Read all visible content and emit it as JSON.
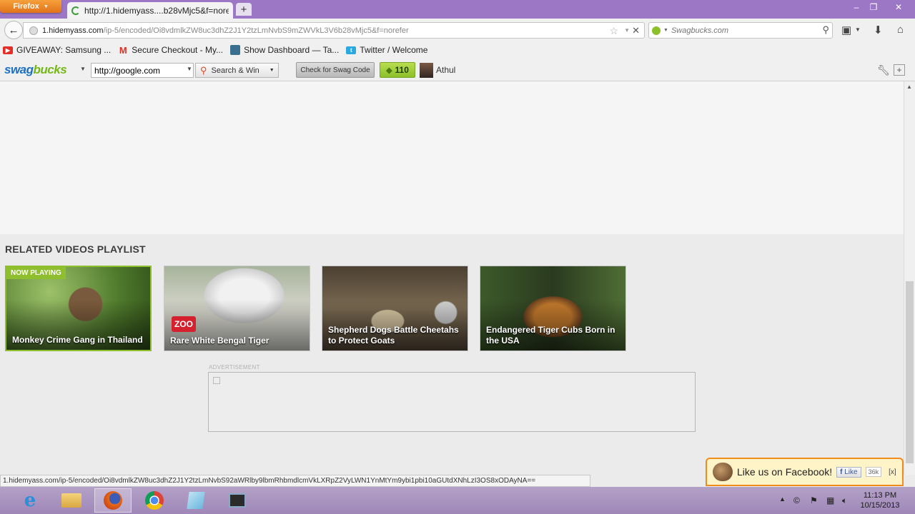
{
  "browser": {
    "menu_label": "Firefox",
    "tab_title": "http://1.hidemyass....b28vMjc5&f=norefer",
    "new_tab_symbol": "+",
    "url_domain": "1.hidemyass.com",
    "url_path": "/ip-5/encoded/Oi8vdmlkZW8uc3dhZ2J1Y2tzLmNvbS9mZWVkL3V6b28vMjc5&f=norefer",
    "search_placeholder": "Swagbucks.com"
  },
  "bookmarks": [
    {
      "label": "GIVEAWAY: Samsung ...",
      "icon": "youtube-icon",
      "color": "#e52d27"
    },
    {
      "label": "Secure Checkout - My...",
      "icon": "gmail-icon",
      "color": "#d93025"
    },
    {
      "label": "Show Dashboard — Ta...",
      "icon": "dashboard-icon",
      "color": "#3a6f8f"
    },
    {
      "label": "Twitter / Welcome",
      "icon": "twitter-icon",
      "color": "#2aa9e0"
    }
  ],
  "swagbucks": {
    "logo_text_a": "swag",
    "logo_text_b": "bucks",
    "search_value": "http://google.com",
    "search_button": "Search & Win",
    "check_button": "Check for Swag Code",
    "points": "110",
    "user": "Athul"
  },
  "page": {
    "related_title": "RELATED VIDEOS PLAYLIST",
    "now_playing": "NOW PLAYING",
    "zoo_label": "ZOO",
    "videos": [
      {
        "title": "Monkey Crime Gang in Thailand"
      },
      {
        "title": "Rare White Bengal Tiger"
      },
      {
        "title": "Shepherd Dogs Battle Cheetahs to Protect Goats"
      },
      {
        "title": "Endangered Tiger Cubs Born in the USA"
      }
    ],
    "ad_label": "ADVERTISEMENT",
    "facebook_text": "Like us on Facebook!",
    "facebook_like": "Like",
    "facebook_count": "36k",
    "facebook_close": "[x]"
  },
  "status_url": "1.hidemyass.com/ip-5/encoded/Oi8vdmlkZW8uc3dhZ2J1Y2tzLmNvbS92aWRlby9lbmRhbmdlcmVkLXRpZ2VyLWN1YnMtYm9ybi1pbi10aGUtdXNhLzI3OS8xODAyNA==",
  "taskbar": {
    "time": "11:13 PM",
    "date": "10/15/2013"
  }
}
